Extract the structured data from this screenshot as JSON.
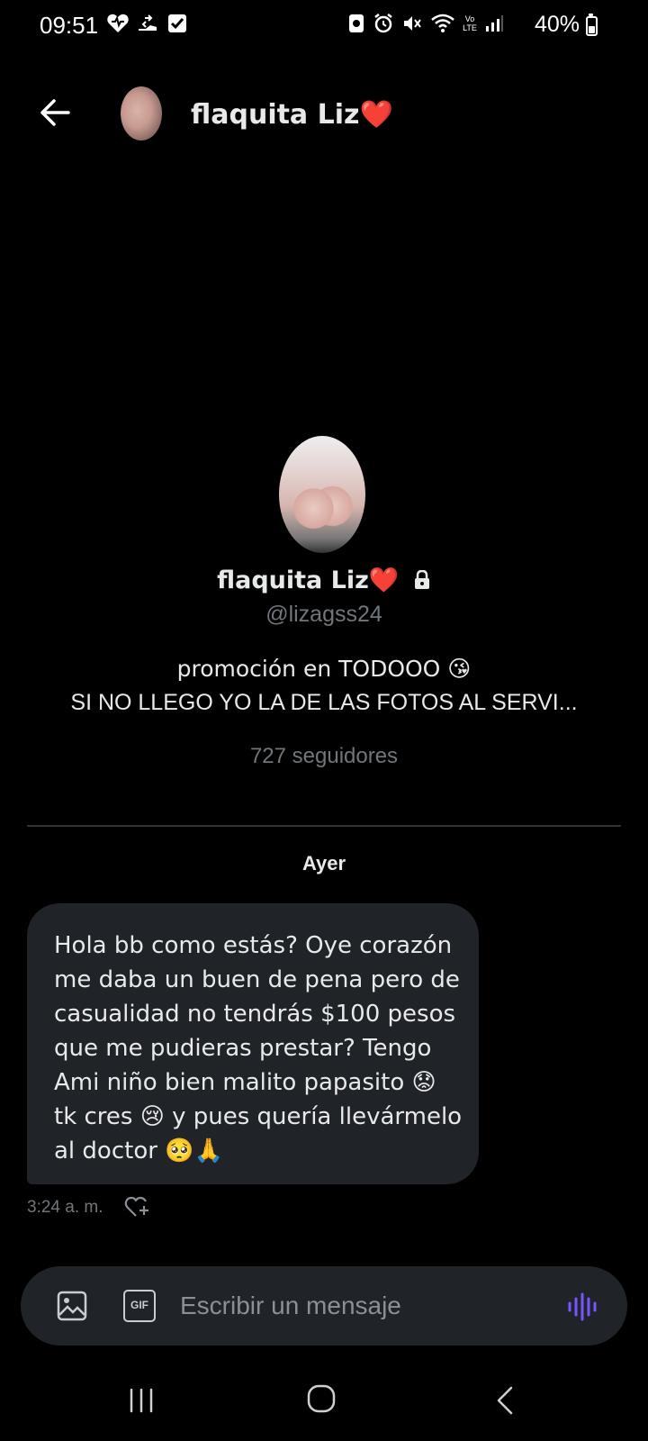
{
  "status_bar": {
    "time": "09:51",
    "battery": "40%",
    "lte_label": "Vo LTE"
  },
  "header": {
    "back_icon": "arrow-left-icon",
    "name": "flaquita Liz❤️"
  },
  "profile": {
    "name": "flaquita Liz❤️",
    "lock_icon": "lock-icon",
    "handle": "@lizagss24",
    "bio_line1": "promoción en TODOOO 😘",
    "bio_line2": "SI NO LLEGO YO LA DE LAS FOTOS AL SERVI...",
    "followers": "727 seguidores"
  },
  "conversation": {
    "date_separator": "Ayer",
    "messages": [
      {
        "lines": [
          "Hola bb como estás? Oye corazón",
          "me daba un buen de pena pero de",
          "casualidad no tendrás $100 pesos",
          "que me pudieras prestar? Tengo",
          "Ami niño bien malito papasito 😟",
          "tk cres 😢 y pues quería llevármelo",
          "al doctor 🥺🙏"
        ],
        "time": "3:24 a. m."
      }
    ]
  },
  "composer": {
    "gif_label": "GIF",
    "placeholder": "Escribir un mensaje",
    "accent_color": "#7856ff"
  },
  "colors": {
    "background": "#000000",
    "bubble": "#202327",
    "muted_text": "#71767b"
  }
}
